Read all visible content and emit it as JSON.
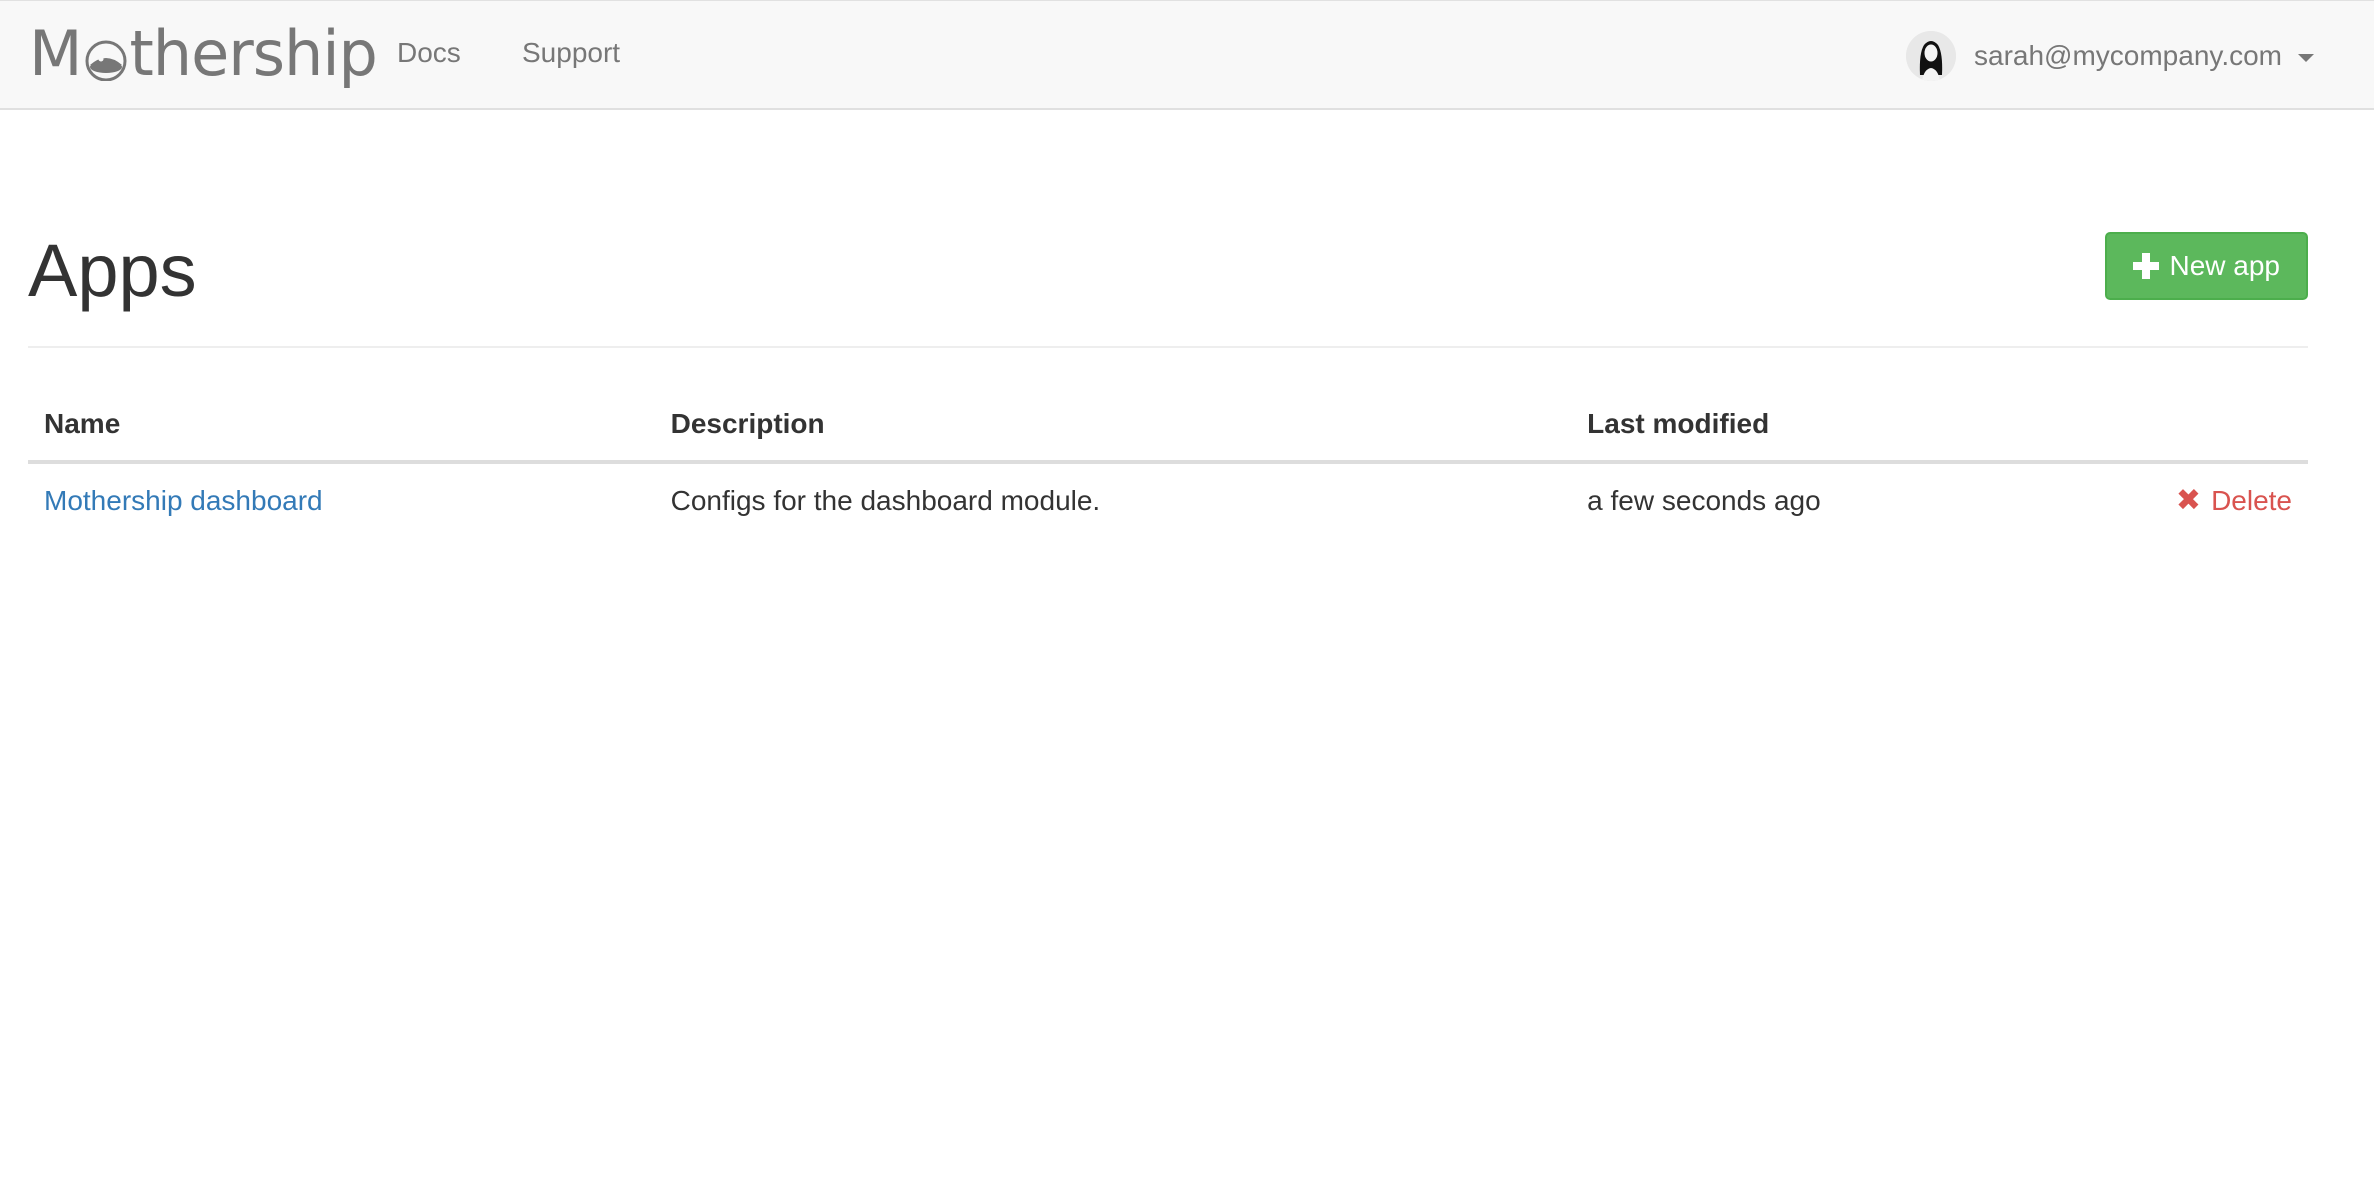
{
  "navbar": {
    "brand": "Mothership",
    "links": [
      "Docs",
      "Support"
    ],
    "user_email": "sarah@mycompany.com"
  },
  "page": {
    "title": "Apps",
    "new_app_label": "New app"
  },
  "table": {
    "headers": [
      "Name",
      "Description",
      "Last modified",
      ""
    ],
    "rows": [
      {
        "name": "Mothership dashboard",
        "description": "Configs for the dashboard module.",
        "last_modified": "a few seconds ago",
        "action": "Delete"
      }
    ]
  },
  "colors": {
    "navbar_bg": "#f8f8f8",
    "link": "#337ab7",
    "success": "#5cb85c",
    "danger": "#d9534f"
  },
  "icons": {
    "brand": "ufo-icon",
    "new_app": "plus-icon",
    "delete": "x-icon",
    "user": "avatar",
    "user_menu": "caret-down-icon"
  }
}
